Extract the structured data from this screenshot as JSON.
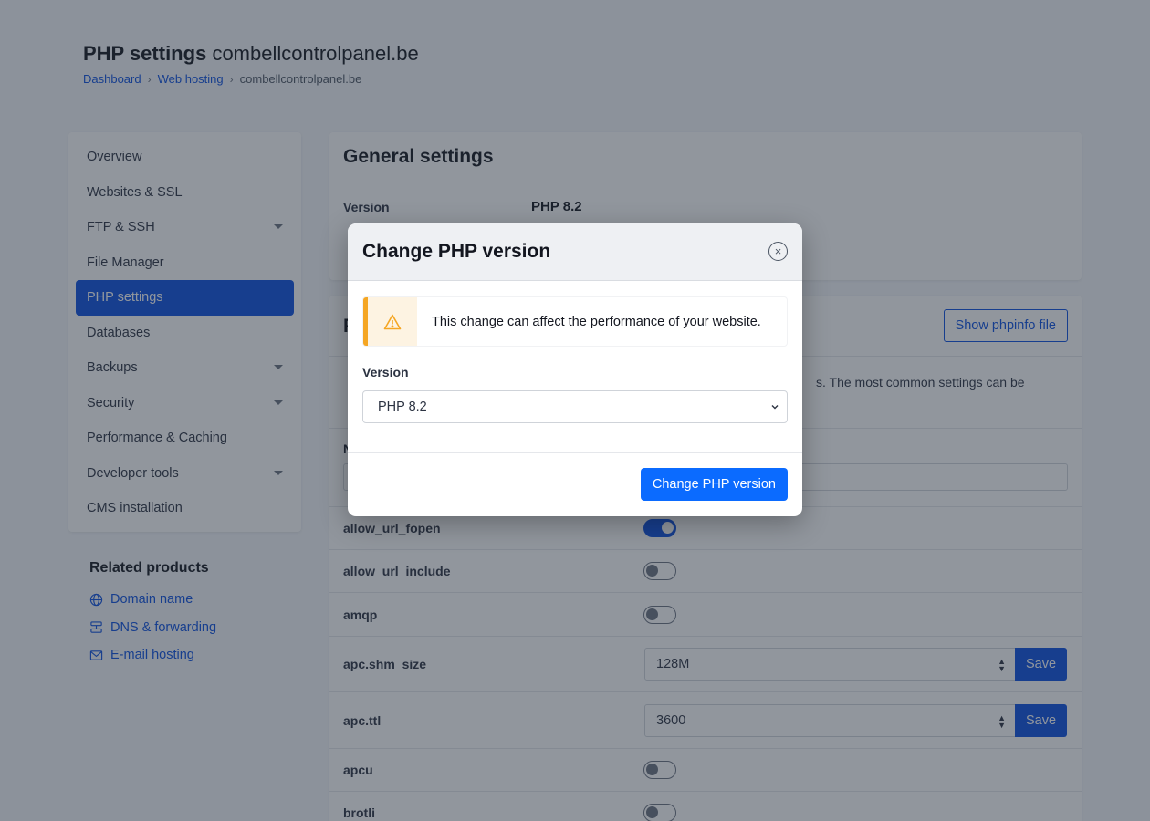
{
  "header": {
    "title_bold": "PHP settings",
    "title_domain": "combellcontrolpanel.be",
    "breadcrumb": [
      "Dashboard",
      "Web hosting",
      "combellcontrolpanel.be"
    ],
    "separator": "›"
  },
  "sidebar": {
    "items": [
      {
        "label": "Overview"
      },
      {
        "label": "Websites & SSL"
      },
      {
        "label": "FTP & SSH"
      },
      {
        "label": "File Manager"
      },
      {
        "label": "PHP settings"
      },
      {
        "label": "Databases"
      },
      {
        "label": "Backups"
      },
      {
        "label": "Security"
      },
      {
        "label": "Performance & Caching"
      },
      {
        "label": "Developer tools"
      },
      {
        "label": "CMS installation"
      }
    ],
    "active": "PHP settings"
  },
  "related": {
    "title": "Related products",
    "items": [
      {
        "label": "Domain name",
        "icon": "globe-icon"
      },
      {
        "label": "DNS & forwarding",
        "icon": "server-icon"
      },
      {
        "label": "E-mail hosting",
        "icon": "mail-icon"
      }
    ]
  },
  "general": {
    "title": "General settings",
    "version_label": "Version",
    "version_value": "PHP 8.2"
  },
  "settings": {
    "title_initial": "P",
    "phpinfo_button": "Show phpinfo file",
    "description_visible": "s. The most common settings can be",
    "search_label_initial": "N",
    "rows": [
      {
        "name": "allow_url_fopen",
        "type": "toggle",
        "on": true
      },
      {
        "name": "allow_url_include",
        "type": "toggle",
        "on": false
      },
      {
        "name": "amqp",
        "type": "toggle",
        "on": false
      },
      {
        "name": "apc.shm_size",
        "type": "select",
        "value": "128M",
        "save": "Save"
      },
      {
        "name": "apc.ttl",
        "type": "select",
        "value": "3600",
        "save": "Save"
      },
      {
        "name": "apcu",
        "type": "toggle",
        "on": false
      },
      {
        "name": "brotli",
        "type": "toggle",
        "on": false
      }
    ]
  },
  "modal": {
    "title": "Change PHP version",
    "warning": "This change can affect the performance of your website.",
    "version_label": "Version",
    "selected_version": "PHP 8.2",
    "submit": "Change PHP version",
    "close_glyph": "×"
  },
  "colors": {
    "accent": "#0b4fe0",
    "primary_button": "#0b6bff",
    "warning": "#f5a623"
  }
}
